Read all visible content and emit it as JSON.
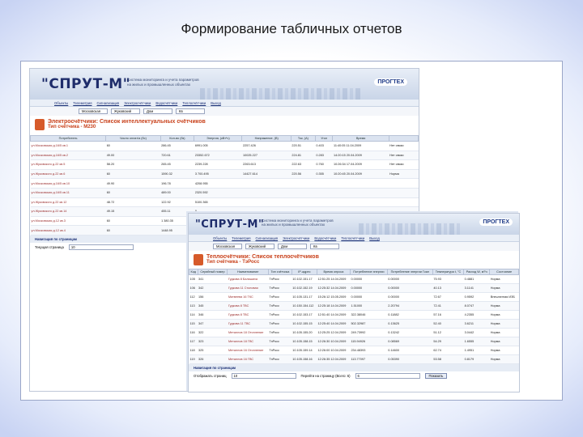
{
  "slide_title": "Формирование табличных отчетов",
  "colors": {
    "accent": "#1f2d6b",
    "heading": "#c9421c"
  },
  "app": {
    "logo": "\"СПРУТ-М\"",
    "banner_line1": "Система мониторинга и учета параметров",
    "banner_line2": "на жилых и промышленных объектах",
    "brand": "ПРОГТЕХ",
    "menu": [
      "Объекты",
      "Телеметрия",
      "Сигнализация",
      "Электросчётчики",
      "Водосчётчики",
      "Теплосчётчики",
      "Выход"
    ]
  },
  "screen1": {
    "filters": [
      "Московская",
      "Жуковский",
      "Дом",
      "Кв"
    ],
    "heading_line1": "Электросчётчики: Список интеллектуальных счётчиков",
    "heading_line2": "Тип счётчика - М230",
    "columns": [
      "Потребитель",
      "Число оплат/а (бс)",
      "Кол-во (бз)",
      "Энергия, (кВт*ч)",
      "Напряжение, (В)",
      "Ток, (А)",
      "Угол",
      "Время"
    ],
    "rows": [
      [
        "ул.Московская д.16/5 кв.1",
        "60",
        "286.45",
        "6991.005",
        "2257.426",
        "220.51",
        "0.403",
        "11:40:05 11.04.2009",
        "Нет связи"
      ],
      [
        "ул.Московская д.16/5 кв.2",
        "49.00",
        "720.61",
        "23352.672",
        "10025.227",
        "224.81",
        "0.283",
        "14:20:15 20.04.2009",
        "Нет связи"
      ],
      [
        "ул.Жуковского д.22 кв.5",
        "58.20",
        "265.45",
        "2239.228",
        "2263.613",
        "222.63",
        "0.760",
        "10:26:34 17.04.2009",
        "Нет связи"
      ],
      [
        "ул.Жуковского д.22 кв.6",
        "60",
        "1590.32",
        "3 700.495",
        "14427.614",
        "220.56",
        "0.355",
        "10:20:45 20.04.2009",
        "Норма"
      ],
      [
        "ул.Московская д.16/5 кв.10",
        "49.90",
        "196.78",
        "4208.955",
        "",
        "",
        "",
        "",
        ""
      ],
      [
        "ул.Московская д.16/5 кв.11",
        "60",
        "489.00",
        "2320.592",
        "",
        "",
        "",
        "",
        ""
      ],
      [
        "ул.Жуковского д.22 кв.12",
        "48.72",
        "122.92",
        "5100.365",
        "",
        "",
        "",
        "",
        ""
      ],
      [
        "ул.Жуковского д.22 кв.14",
        "49.15",
        "455.11",
        "0",
        "",
        "",
        "",
        "",
        ""
      ],
      [
        "ул.Московская д.12 кв.3",
        "60",
        "1 380.35",
        "34007.111",
        "",
        "",
        "",
        "",
        ""
      ],
      [
        "ул.Московская д.12 кв.4",
        "60",
        "1448.95",
        "25400.791",
        "",
        "",
        "",
        "",
        ""
      ]
    ],
    "nav_label": "Навигация по страницам",
    "pager_label": "Текущая страница",
    "pager_value": "10"
  },
  "screen2": {
    "filters": [
      "Московская",
      "Жуковский",
      "Дом",
      "Кв"
    ],
    "heading_line1": "Теплосчётчики: Список теплосчётчиков",
    "heading_line2": "Тип счётчика - ТэРосс",
    "columns": [
      "Код",
      "Серийный номер",
      "Наименование",
      "Тип счётчика",
      "IP-адрес",
      "Время опроса",
      "Потребление энергии",
      "Потребление энергии Гкал",
      "Температура t, °С",
      "Расход W, м³/ч",
      "Давление P, атм",
      "Состояние"
    ],
    "rows": [
      [
        "105",
        "341",
        "Гудкова 8 Балашиха",
        "ТэРосс",
        "10.102.151.17",
        "12:51:25 14.04.2009",
        "0.00000",
        "0.00000",
        "75.93",
        "0.4881",
        "Норма"
      ],
      [
        "106",
        "342",
        "Гудкова 11 Столовая",
        "ТэРосс",
        "10.102.152.19",
        "12:25:32 14.04.2009",
        "0.00000",
        "0.00000",
        "40.13",
        "3.1141",
        "Норма"
      ],
      [
        "112",
        "156",
        "Матвеева 16 ТКС",
        "ТэРосс",
        "10.105.131.17",
        "15:26:12 15.05.2009",
        "0.00000",
        "0.00000",
        "72.67",
        "0.9592",
        "Внештатная ИЗБ"
      ],
      [
        "113",
        "345",
        "Гудкова 8 ТВС",
        "ТэРосс",
        "10.150.154.112",
        "12:25:18 14.04.2009",
        "1.51000",
        "2.20794",
        "72.41",
        "8.0747",
        "Норма"
      ],
      [
        "114",
        "346",
        "Гудкова 8 ТВС",
        "ТэРосс",
        "10.102.153.17",
        "12:51:40 14.04.2009",
        "322.38046",
        "0.11882",
        "57.16",
        "4.2355",
        "Норма"
      ],
      [
        "115",
        "347",
        "Гудкова 11 ТВС",
        "ТэРосс",
        "10.102.155.15",
        "12:25:40 14.04.2009",
        "502.32987",
        "0.13625",
        "52.40",
        "3.6211",
        "Норма"
      ],
      [
        "116",
        "322",
        "Металлов 18 Отопление",
        "ТэРосс",
        "10.105.155.20",
        "12:25:25 12.04.2009",
        "249.73992",
        "0.13242",
        "51.12",
        "3.0442",
        "Норма"
      ],
      [
        "117",
        "323",
        "Металлов 18 ГВС",
        "ТэРосс",
        "10.105.158.15",
        "12:26:30 10.04.2009",
        "115.94926",
        "0.08569",
        "54.29",
        "1.6555",
        "Норма"
      ],
      [
        "118",
        "325",
        "Металлов 16 Отопление",
        "ТэРосс",
        "10.105.159.14",
        "12:26:00 10.04.2009",
        "234.48393",
        "0.14600",
        "62.74",
        "1.4951",
        "Норма"
      ],
      [
        "119",
        "326",
        "Металлов 16 ГВС",
        "ТэРосс",
        "10.105.158.16",
        "12:26:35 12.04.2009",
        "113.77097",
        "0.05390",
        "53.58",
        "0.8179",
        "Норма"
      ]
    ],
    "nav_label": "Навигация по страницам",
    "pager_label": "Отображать страниц",
    "pager_value": "10",
    "goto_label": "Перейти на страницу (Всего: 6)",
    "goto_value": "6",
    "show_button": "Показать"
  }
}
